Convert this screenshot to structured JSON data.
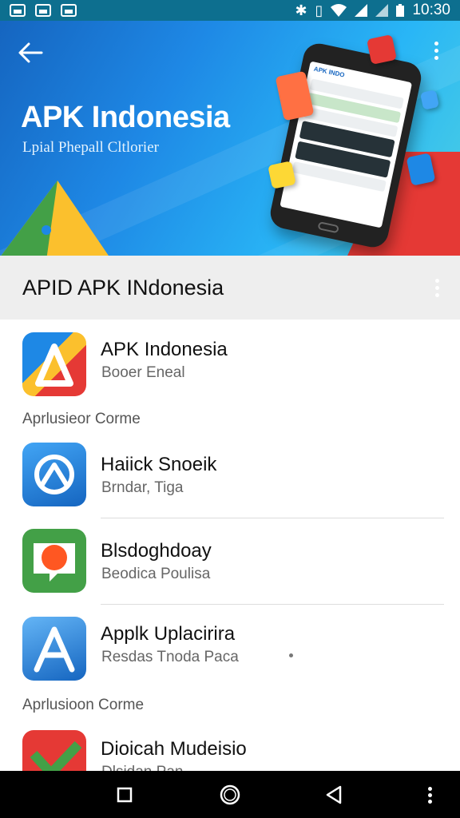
{
  "status_bar": {
    "time": "10:30",
    "icons": [
      "image-icon",
      "image-icon",
      "image-icon",
      "bluetooth-icon",
      "vibrate-icon",
      "wifi-icon",
      "signal-icon",
      "signal-icon",
      "battery-icon"
    ]
  },
  "hero": {
    "title": "APK Indonesia",
    "subtitle": "Lpial Phepall Cltlorier"
  },
  "section": {
    "title": "APID APK INdonesia"
  },
  "list": [
    {
      "name": "APK Indonesia",
      "sub": "Booer Eneal",
      "icon": "apk-indonesia-icon",
      "colors": [
        "#1e88e5",
        "#fbc02d",
        "#e53935"
      ]
    },
    {
      "name": "Haiick Snoeik",
      "sub": "Brndar, Tiga",
      "icon": "refresh-app-icon",
      "colors": [
        "#1e88e5",
        "#42a5f5"
      ]
    },
    {
      "name": "Blsdoghdoay",
      "sub": "Beodica Poulisa",
      "icon": "chat-bubble-icon",
      "colors": [
        "#43a047",
        "#ff7043"
      ]
    },
    {
      "name": "Applk Uplacirira",
      "sub": "Resdas Tnoda Paca",
      "icon": "app-store-a-icon",
      "colors": [
        "#1e88e5",
        "#64b5f6"
      ]
    },
    {
      "name": "Dioicah Mudeisio",
      "sub": "Dlsidan Pan",
      "icon": "check-app-icon",
      "colors": [
        "#e53935",
        "#43a047"
      ]
    }
  ],
  "groups": [
    "Aprlusieor Corme",
    "Aprlusioon Corme"
  ]
}
